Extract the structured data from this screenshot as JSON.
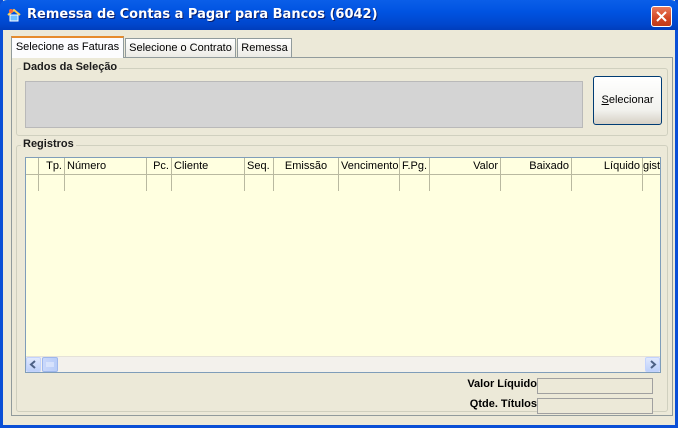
{
  "window": {
    "title": "Remessa de Contas a Pagar para Bancos (6042)"
  },
  "tabs": [
    {
      "label": "Selecione as Faturas",
      "active": true
    },
    {
      "label": "Selecione o Contrato",
      "active": false
    },
    {
      "label": "Remessa",
      "active": false
    }
  ],
  "selection": {
    "group_label": "Dados da Seleção",
    "button_label": "Selecionar",
    "button_accel": "S"
  },
  "records": {
    "group_label": "Registros",
    "columns": [
      "",
      "Tp.",
      "Número",
      "Pc.",
      "Cliente",
      "Seq.",
      "Emissão",
      "Vencimento",
      "F.Pg.",
      "Valor",
      "Baixado",
      "Líquido",
      "gist"
    ],
    "rows": []
  },
  "summary": {
    "valor_liquido_label": "Valor Líquido",
    "valor_liquido_value": "",
    "qtde_titulos_label": "Qtde. Títulos",
    "qtde_titulos_value": ""
  },
  "icons": {
    "app": "app-icon",
    "close": "close-icon",
    "scroll_left": "arrow-left-icon",
    "scroll_right": "arrow-right-icon"
  },
  "colors": {
    "titlebar": "#0053e1",
    "grid_background": "#ffffe0",
    "selection_box": "#d4d4d4",
    "active_tab_accent": "#e68b2c"
  }
}
